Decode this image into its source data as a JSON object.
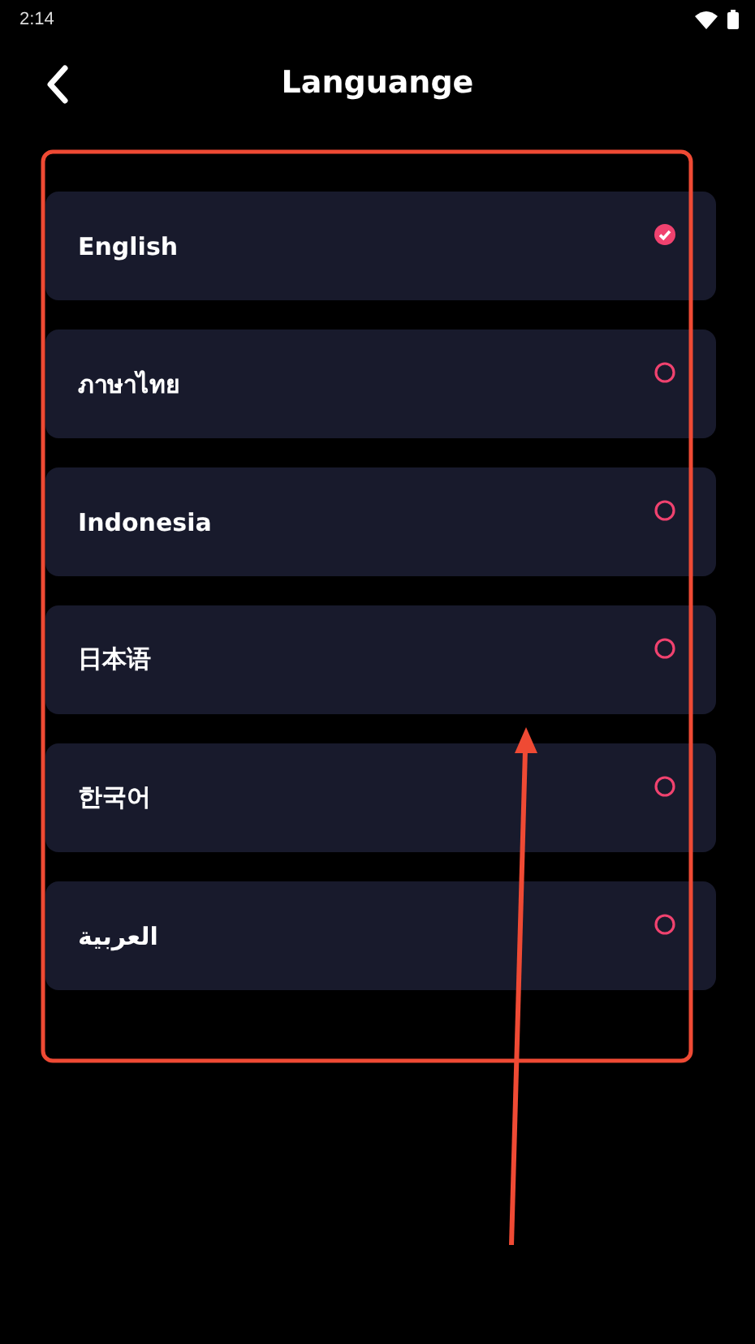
{
  "status_bar": {
    "time": "2:14"
  },
  "header": {
    "title": "Languange"
  },
  "languages": [
    {
      "label": "English",
      "selected": true
    },
    {
      "label": "ภาษาไทย",
      "selected": false
    },
    {
      "label": "Indonesia",
      "selected": false
    },
    {
      "label": "日本语",
      "selected": false
    },
    {
      "label": "한국어",
      "selected": false
    },
    {
      "label": "العربية",
      "selected": false
    }
  ]
}
